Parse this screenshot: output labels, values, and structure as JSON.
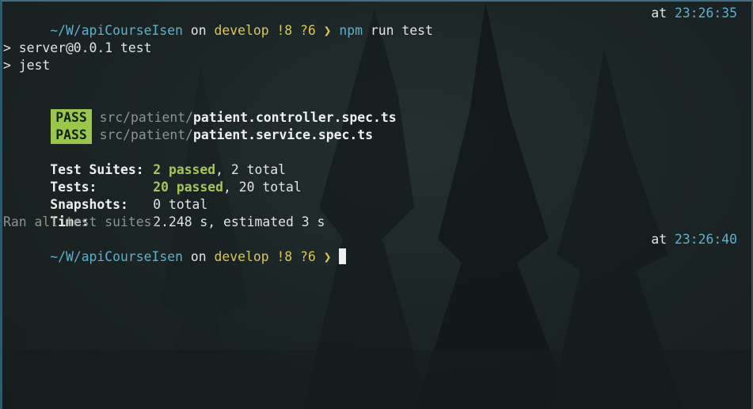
{
  "prompt1": {
    "path": "~/W/apiCourseIsen",
    "on": "on",
    "branch": "develop",
    "status": "!8 ?6",
    "arrow": "❯",
    "command": "npm run test",
    "at": "at",
    "time": "23:26:35"
  },
  "npm": {
    "line1": "> server@0.0.1 test",
    "line2": "> jest"
  },
  "results": [
    {
      "badge": "PASS",
      "dir": "src/patient/",
      "file": "patient.controller.spec.ts"
    },
    {
      "badge": "PASS",
      "dir": "src/patient/",
      "file": "patient.service.spec.ts"
    }
  ],
  "summary": {
    "suites_label": "Test Suites:",
    "suites_passed": "2 passed",
    "suites_total": ", 2 total",
    "tests_label": "Tests:",
    "tests_passed": "20 passed",
    "tests_total": ", 20 total",
    "snapshots_label": "Snapshots:",
    "snapshots_value": "0 total",
    "time_label": "Time:",
    "time_value": "2.248 s, estimated 3 s",
    "ran": "Ran all test suites."
  },
  "prompt2": {
    "path": "~/W/apiCourseIsen",
    "on": "on",
    "branch": "develop",
    "status": "!8 ?6",
    "arrow": "❯",
    "at": "at",
    "time": "23:26:40"
  },
  "colors": {
    "path": "#5fb0cc",
    "branch": "#d8c85a",
    "pass_badge": "#9ac64c",
    "passed_text": "#a3c75a"
  }
}
